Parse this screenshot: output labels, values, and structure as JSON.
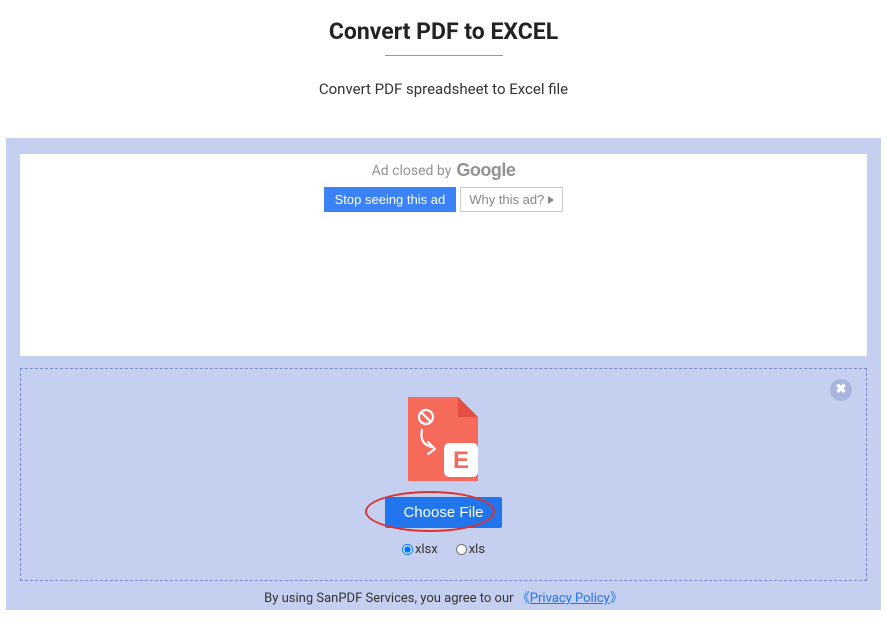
{
  "header": {
    "title": "Convert PDF to EXCEL",
    "subtitle": "Convert PDF spreadsheet to Excel file"
  },
  "ad": {
    "closed_text": "Ad closed by",
    "google": "Google",
    "stop_label": "Stop seeing this ad",
    "why_label": "Why this ad?"
  },
  "dropzone": {
    "choose_file_label": "Choose File",
    "radios": {
      "xlsx": "xlsx",
      "xls": "xls"
    },
    "close_icon": "✖"
  },
  "footer": {
    "text": "By using SanPDF Services, you agree to our ",
    "bracket_open": "《",
    "link_text": "Privacy Policy",
    "bracket_close": "》"
  }
}
